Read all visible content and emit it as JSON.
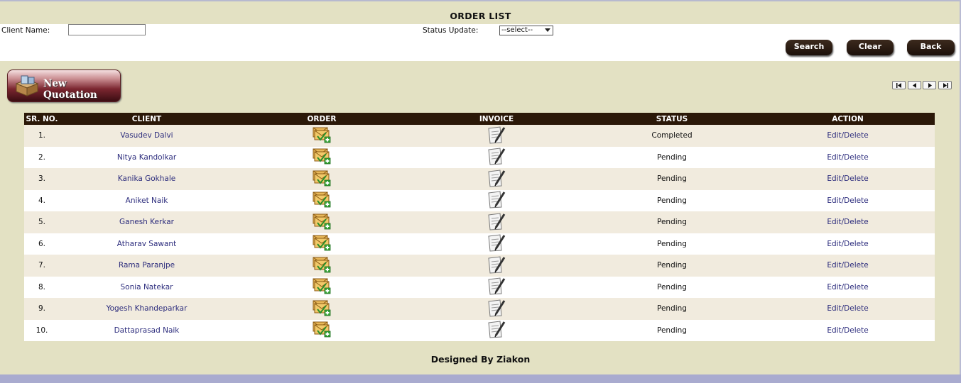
{
  "page_title": "ORDER LIST",
  "search": {
    "client_name_label": "Client Name:",
    "client_name_value": "",
    "status_label": "Status Update:",
    "status_selected": "--select--"
  },
  "buttons": {
    "search": "Search",
    "clear": "Clear",
    "back": "Back"
  },
  "new_quotation_label": "New Quotation",
  "table": {
    "headers": [
      "SR. NO.",
      "CLIENT",
      "ORDER",
      "INVOICE",
      "STATUS",
      "ACTION"
    ],
    "rows": [
      {
        "sr": "1.",
        "client": "Vasudev Dalvi",
        "status": "Completed",
        "action": "Edit/Delete"
      },
      {
        "sr": "2.",
        "client": "Nitya Kandolkar",
        "status": "Pending",
        "action": "Edit/Delete"
      },
      {
        "sr": "3.",
        "client": "Kanika Gokhale",
        "status": "Pending",
        "action": "Edit/Delete"
      },
      {
        "sr": "4.",
        "client": "Aniket Naik",
        "status": "Pending",
        "action": "Edit/Delete"
      },
      {
        "sr": "5.",
        "client": "Ganesh Kerkar",
        "status": "Pending",
        "action": "Edit/Delete"
      },
      {
        "sr": "6.",
        "client": "Atharav Sawant",
        "status": "Pending",
        "action": "Edit/Delete"
      },
      {
        "sr": "7.",
        "client": "Rama Paranjpe",
        "status": "Pending",
        "action": "Edit/Delete"
      },
      {
        "sr": "8.",
        "client": "Sonia Natekar",
        "status": "Pending",
        "action": "Edit/Delete"
      },
      {
        "sr": "9.",
        "client": "Yogesh Khandeparkar",
        "status": "Pending",
        "action": "Edit/Delete"
      },
      {
        "sr": "10.",
        "client": "Dattaprasad Naik",
        "status": "Pending",
        "action": "Edit/Delete"
      }
    ]
  },
  "footer": "Designed By Ziakon",
  "colors": {
    "background": "#e3e1c3",
    "header_bar": "#2b1808",
    "link": "#2d2d7d",
    "button": "#2a1a10"
  },
  "icons": {
    "order": "order-envelope-icon",
    "invoice": "invoice-pen-icon",
    "quotation": "quotation-box-icon",
    "pager": [
      "first-page-icon",
      "prev-page-icon",
      "next-page-icon",
      "last-page-icon"
    ]
  }
}
